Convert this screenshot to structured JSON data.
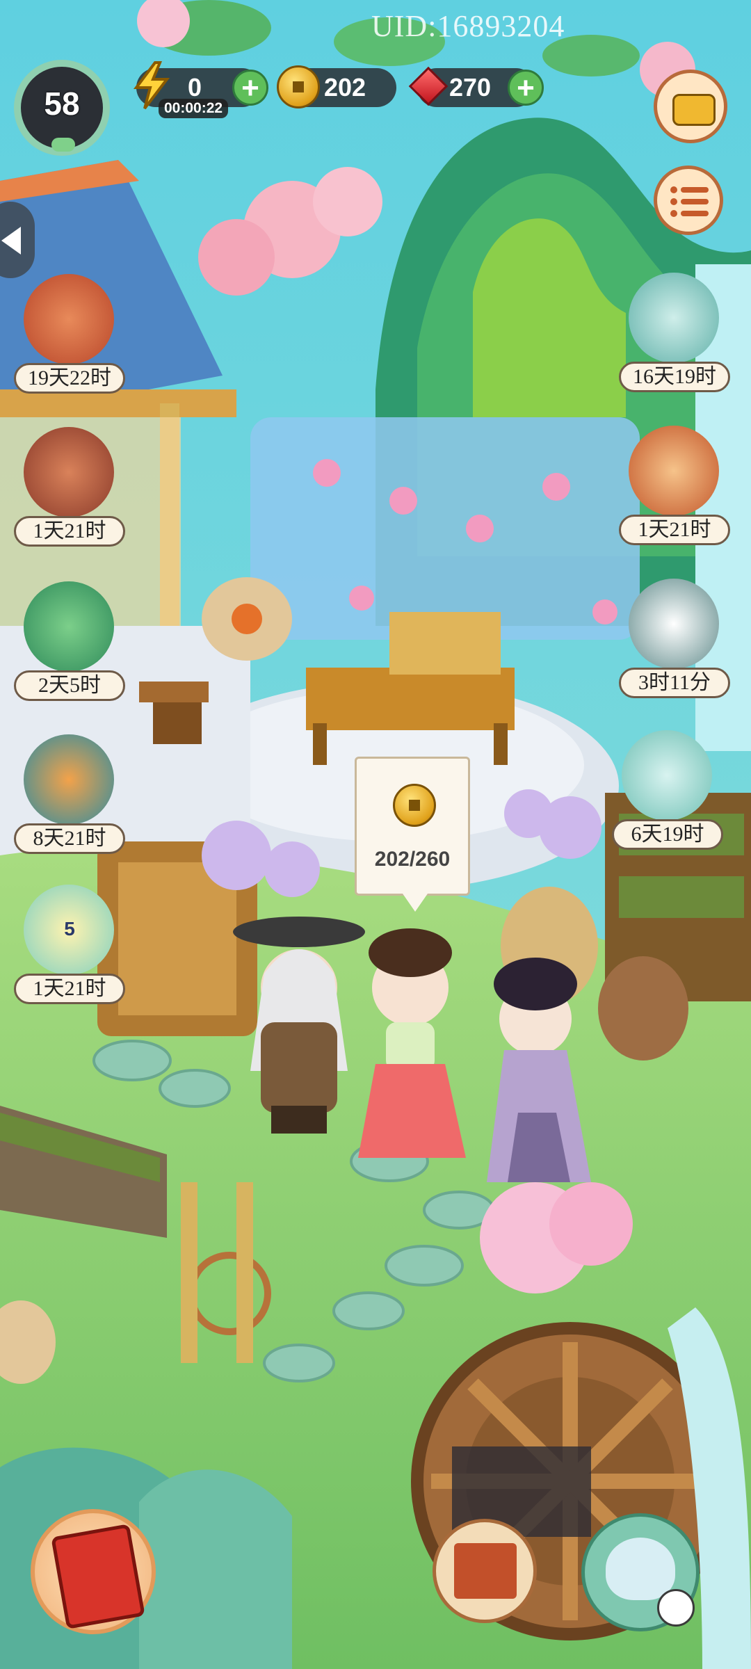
{
  "uid": "UID:16893204",
  "player": {
    "level": "58"
  },
  "resources": {
    "energy": {
      "value": "0",
      "timer": "00:00:22"
    },
    "coins": {
      "value": "202"
    },
    "gems": {
      "value": "270"
    }
  },
  "events_left": [
    {
      "id": "event-book",
      "icon": "book-scroll-icon",
      "time": "19天22时"
    },
    {
      "id": "event-teapot",
      "icon": "teapot-icon",
      "time": "1天21时"
    },
    {
      "id": "event-calendar-gate",
      "icon": "calendar-gate-icon",
      "time": "2天5时"
    },
    {
      "id": "event-peacock",
      "icon": "peacock-icon",
      "time": "8天21时"
    },
    {
      "id": "event-lotus",
      "icon": "lotus-icon",
      "time": "1天21时",
      "badge": "5"
    }
  ],
  "events_right": [
    {
      "id": "event-cat-dragon",
      "icon": "cat-dragon-icon",
      "time": "16天19时"
    },
    {
      "id": "event-cat-fan",
      "icon": "cat-fan-icon",
      "time": "1天21时"
    },
    {
      "id": "event-snow-mountain",
      "icon": "snow-mountain-icon",
      "time": "3时11分"
    },
    {
      "id": "event-gift-cat",
      "icon": "gift-cat-icon",
      "time": "6天19时"
    }
  ],
  "coin_bubble": {
    "text": "202/260"
  },
  "colors": {
    "sky": "#4fc4d8",
    "grass": "#8ccf6a",
    "path": "#dfe6ee",
    "pill": "#2c2c30",
    "plus": "#5fbf5a"
  }
}
